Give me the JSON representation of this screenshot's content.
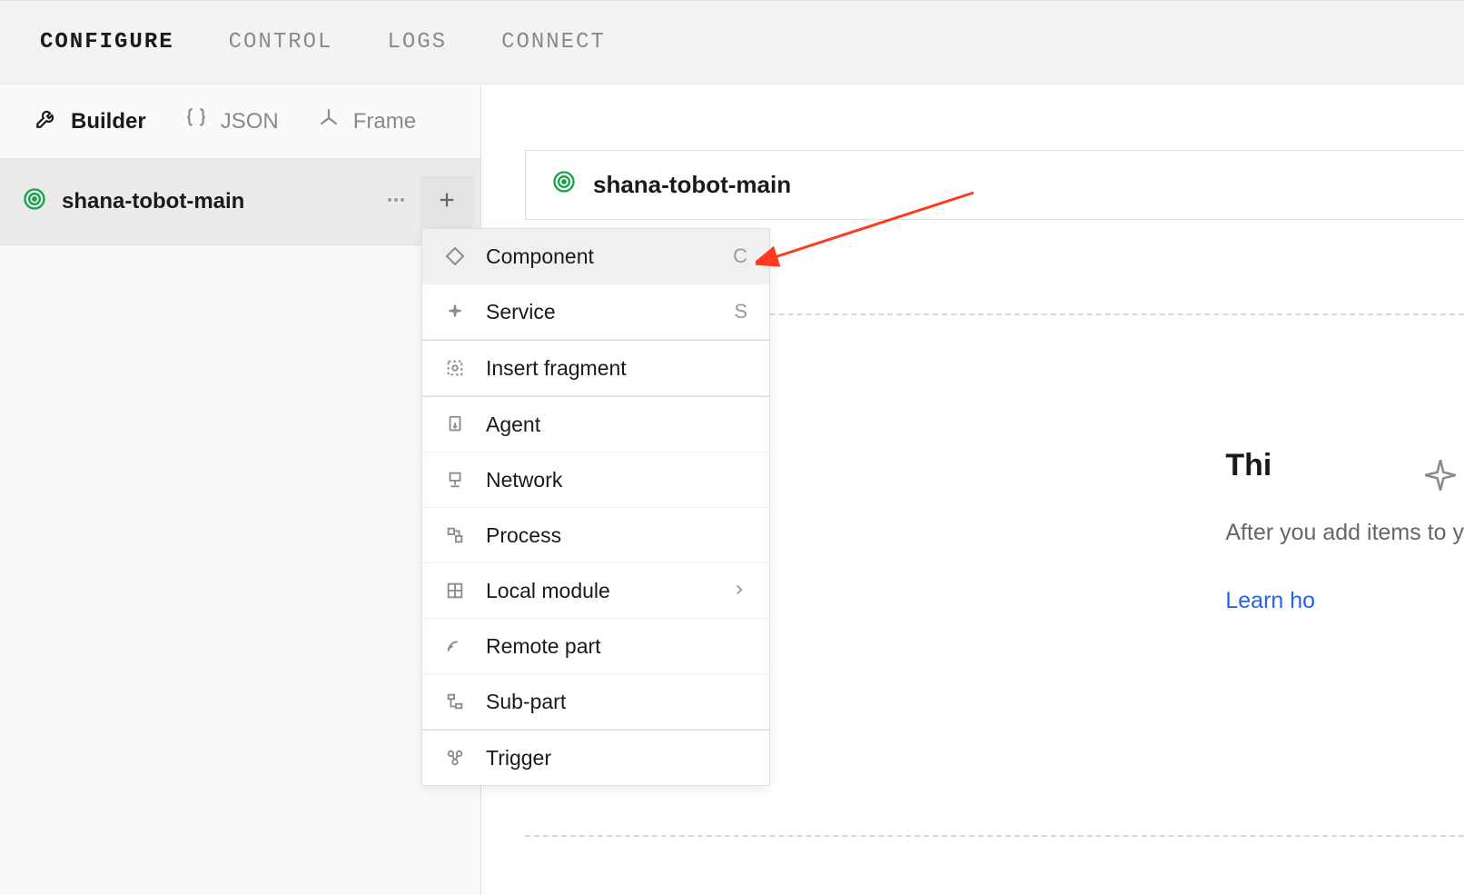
{
  "topTabs": {
    "configure": "CONFIGURE",
    "control": "CONTROL",
    "logs": "LOGS",
    "connect": "CONNECT"
  },
  "sidebarModes": {
    "builder": "Builder",
    "json": "JSON",
    "frame": "Frame"
  },
  "tree": {
    "rootName": "shana-tobot-main"
  },
  "breadcrumb": {
    "label": "shana-tobot-main"
  },
  "dropdown": {
    "component": {
      "label": "Component",
      "shortcut": "C"
    },
    "service": {
      "label": "Service",
      "shortcut": "S"
    },
    "insertFragment": {
      "label": "Insert fragment"
    },
    "agent": {
      "label": "Agent"
    },
    "network": {
      "label": "Network"
    },
    "process": {
      "label": "Process"
    },
    "localModule": {
      "label": "Local module"
    },
    "remotePart": {
      "label": "Remote part"
    },
    "subPart": {
      "label": "Sub-part"
    },
    "trigger": {
      "label": "Trigger"
    }
  },
  "emptyState": {
    "headerFragment": "Thi",
    "subFragment": "After you add items to y",
    "linkFragment": "Learn ho"
  }
}
